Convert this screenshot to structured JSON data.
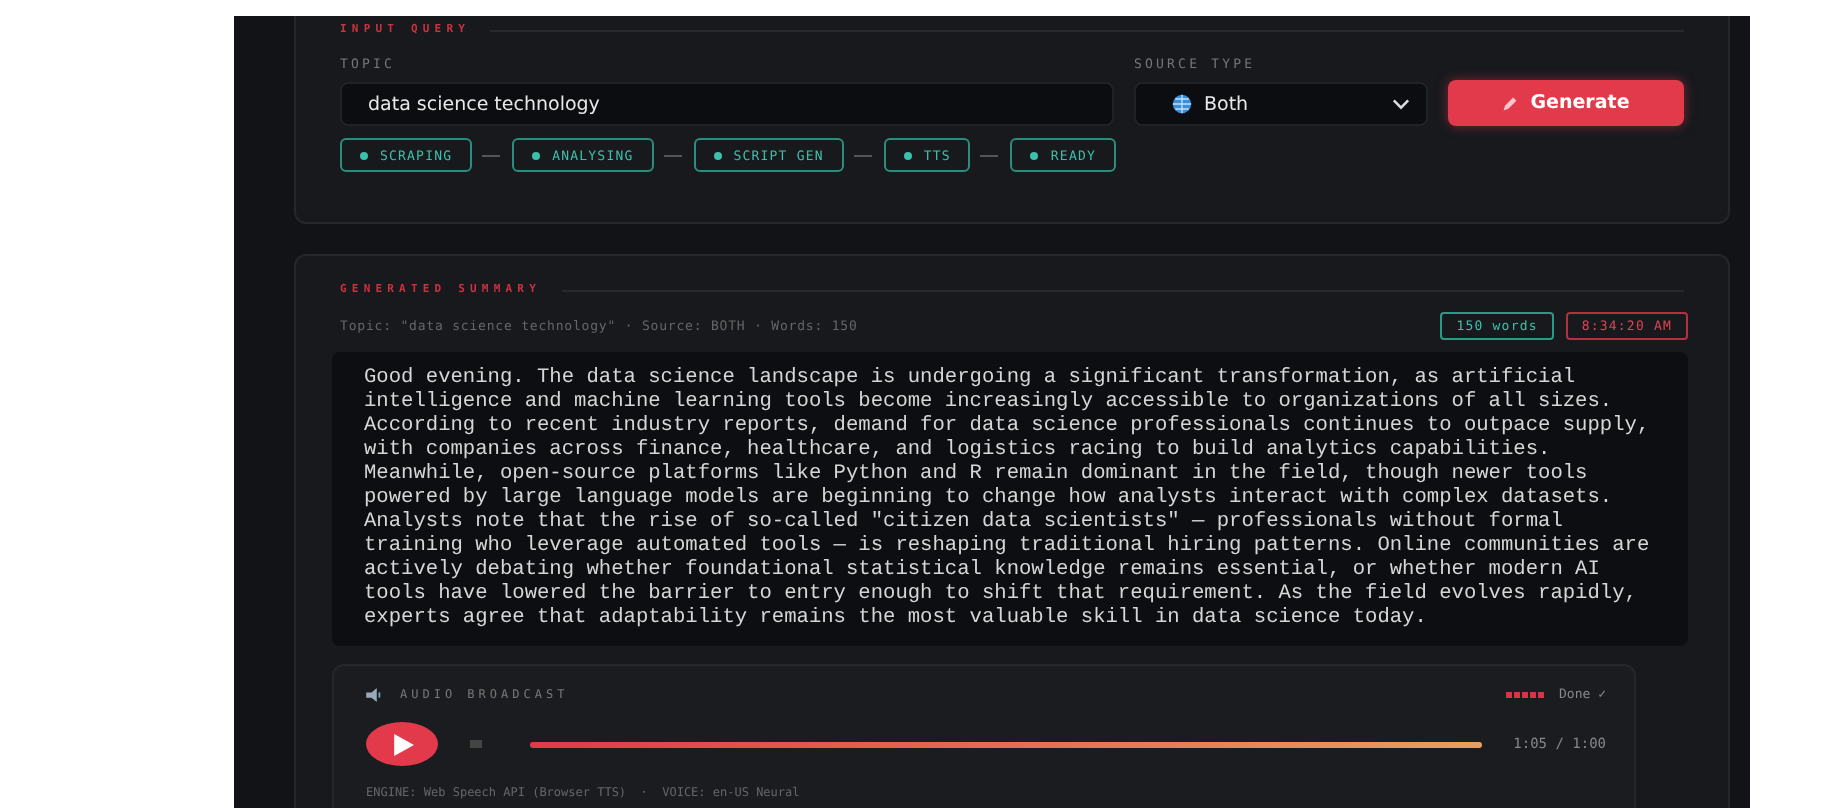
{
  "input_query": {
    "heading": "INPUT QUERY",
    "topic_label": "TOPIC",
    "topic_value": "data science technology",
    "source_label": "SOURCE TYPE",
    "source_value": "Both",
    "generate_label": "Generate",
    "stages": [
      {
        "label": "SCRAPING",
        "done": true
      },
      {
        "label": "ANALYSING",
        "done": true
      },
      {
        "label": "SCRIPT GEN",
        "done": true
      },
      {
        "label": "TTS",
        "done": true
      },
      {
        "label": "READY",
        "done": true
      }
    ]
  },
  "summary": {
    "heading": "GENERATED SUMMARY",
    "meta": "Topic: \"data science technology\" · Source: BOTH · Words: 150",
    "word_badge": "150 words",
    "time_badge": "8:34:20 AM",
    "text": "Good evening. The data science landscape is undergoing a significant transformation, as artificial intelligence and machine learning tools become increasingly accessible to organizations of all sizes. According to recent industry reports, demand for data science professionals continues to outpace supply, with companies across finance, healthcare, and logistics racing to build analytics capabilities. Meanwhile, open-source platforms like Python and R remain dominant in the field, though newer tools powered by large language models are beginning to change how analysts interact with complex datasets. Analysts note that the rise of so-called \"citizen data scientists\" — professionals without formal training who leverage automated tools — is reshaping traditional hiring patterns. Online communities are actively debating whether foundational statistical knowledge remains essential, or whether modern AI tools have lowered the barrier to entry enough to shift that requirement. As the field evolves rapidly, experts agree that adaptability remains the most valuable skill in data science today."
  },
  "audio": {
    "heading": "AUDIO BROADCAST",
    "status": "Done ✓",
    "level": 1,
    "time": "1:05 / 1:00",
    "engine": "ENGINE: Web Speech API (Browser TTS)  ·  VOICE: en-US Neural"
  }
}
